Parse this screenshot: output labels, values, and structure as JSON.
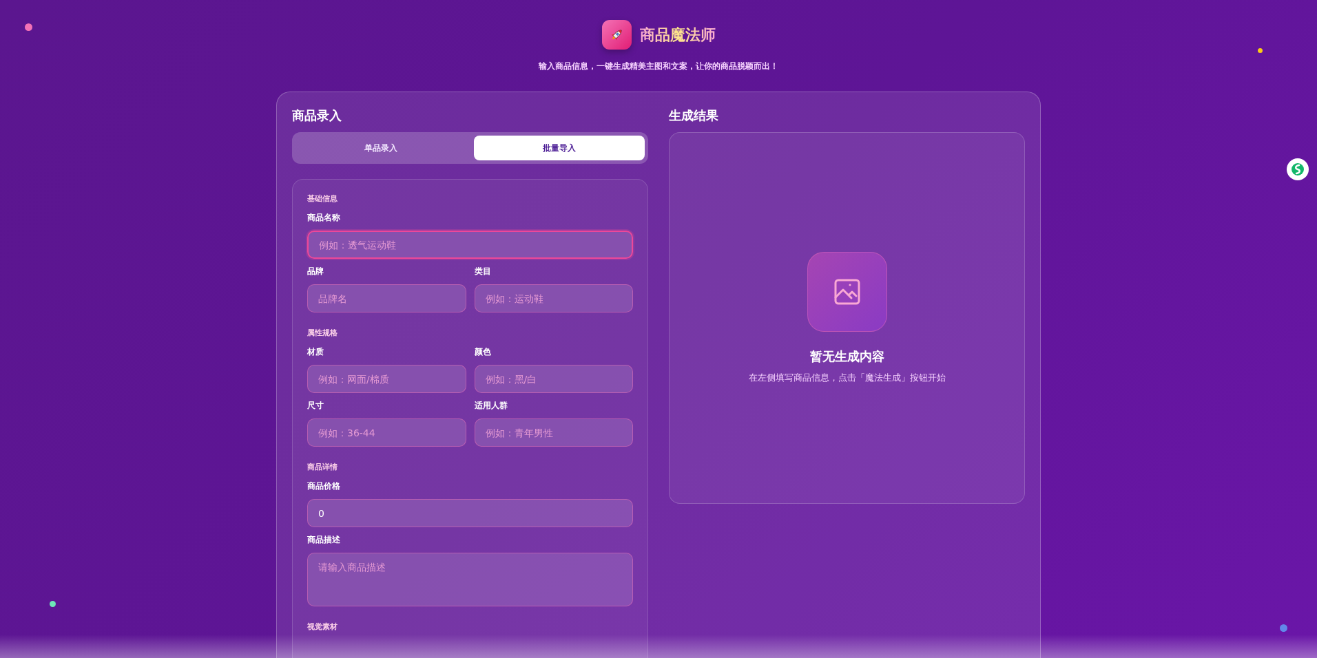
{
  "header": {
    "title": "商品魔法师",
    "subtitle": "输入商品信息，一键生成精美主图和文案，让你的商品脱颖而出！"
  },
  "input_panel": {
    "title": "商品录入",
    "tabs": [
      {
        "label": "单品录入",
        "selected": false
      },
      {
        "label": "批量导入",
        "selected": true
      }
    ],
    "sections": [
      {
        "title": "基础信息",
        "rows": [
          [
            {
              "label": "商品名称",
              "placeholder": "例如：透气运动鞋",
              "focused": true
            }
          ],
          [
            {
              "label": "品牌",
              "placeholder": "品牌名",
              "focused": false
            },
            {
              "label": "类目",
              "placeholder": "例如：运动鞋",
              "focused": false
            }
          ]
        ]
      },
      {
        "title": "属性规格",
        "rows": [
          [
            {
              "label": "材质",
              "placeholder": "例如：网面/棉质",
              "focused": false
            },
            {
              "label": "颜色",
              "placeholder": "例如：黑/白",
              "focused": false
            }
          ],
          [
            {
              "label": "尺寸",
              "placeholder": "例如：36-44",
              "focused": false
            },
            {
              "label": "适用人群",
              "placeholder": "例如：青年男性",
              "focused": false
            }
          ]
        ]
      },
      {
        "title": "商品详情",
        "rows": [
          [
            {
              "label": "商品价格",
              "value": "0",
              "focused": false
            }
          ],
          [
            {
              "label": "商品描述",
              "placeholder": "请输入商品描述",
              "kind": "textarea",
              "focused": false
            }
          ]
        ]
      },
      {
        "title": "视觉素材"
      }
    ]
  },
  "result_panel": {
    "title": "生成结果",
    "empty_title": "暂无生成内容",
    "empty_hint": "在左侧填写商品信息，点击「魔法生成」按钮开始"
  }
}
